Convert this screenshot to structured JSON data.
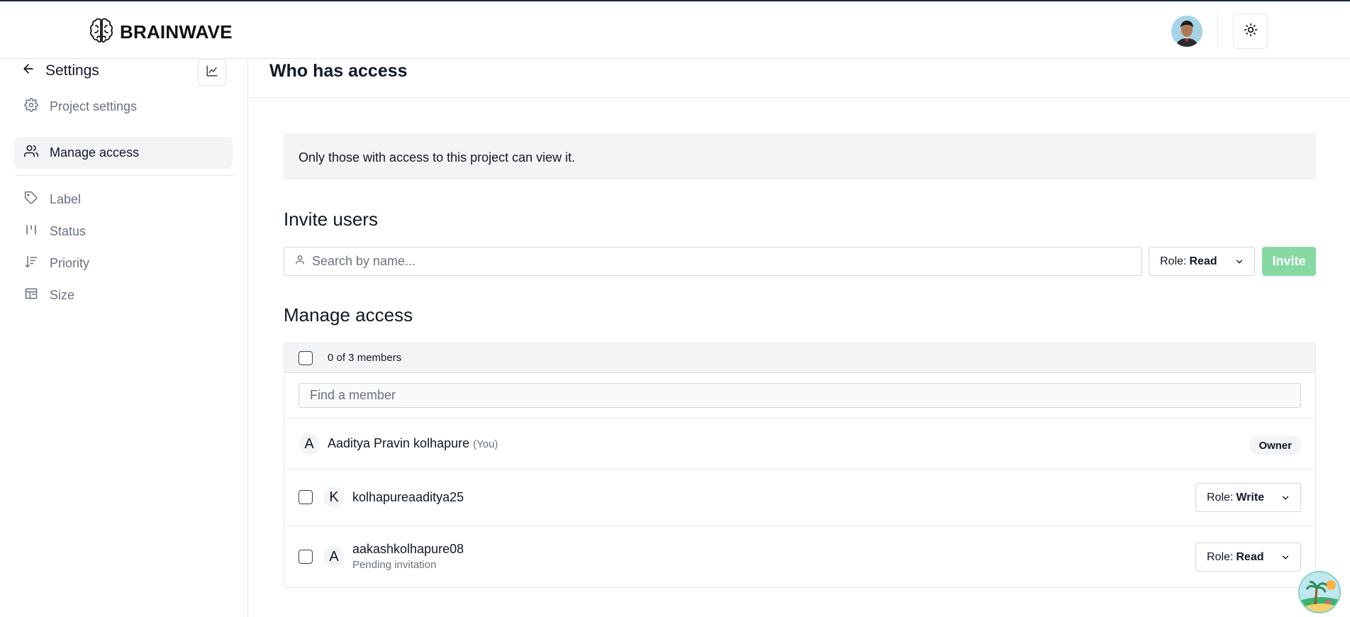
{
  "header": {
    "brand": "BRAINWAVE",
    "icons": {
      "logo": "brain-icon",
      "theme": "sun-icon"
    }
  },
  "sidebar": {
    "title": "Settings",
    "back_icon": "arrow-left-icon",
    "chart_icon": "line-chart-icon",
    "items": [
      {
        "label": "Project settings",
        "icon": "gear-icon",
        "active": false
      },
      {
        "label": "Manage access",
        "icon": "users-icon",
        "active": true
      },
      {
        "label": "Label",
        "icon": "tag-icon",
        "active": false
      },
      {
        "label": "Status",
        "icon": "status-icon",
        "active": false
      },
      {
        "label": "Priority",
        "icon": "priority-icon",
        "active": false
      },
      {
        "label": "Size",
        "icon": "layout-icon",
        "active": false
      }
    ]
  },
  "main": {
    "title": "Who has access",
    "notice": "Only those with access to this project can view it.",
    "invite": {
      "heading": "Invite users",
      "search_placeholder": "Search by name...",
      "role_prefix": "Role:",
      "role_value": "Read",
      "button": "Invite"
    },
    "manage": {
      "heading": "Manage access",
      "count": "0 of 3 members",
      "find_placeholder": "Find a member",
      "members": [
        {
          "initial": "A",
          "name": "Aaditya Pravin kolhapure",
          "you": "(You)",
          "badge": "Owner"
        },
        {
          "initial": "K",
          "name": "kolhapureaaditya25",
          "role_prefix": "Role:",
          "role": "Write"
        },
        {
          "initial": "A",
          "name": "aakashkolhapure08",
          "sub": "Pending invitation",
          "role_prefix": "Role:",
          "role": "Read"
        }
      ]
    }
  },
  "colors": {
    "accent_invite": "#86d9a2",
    "active_bg": "#f3f4f6"
  }
}
